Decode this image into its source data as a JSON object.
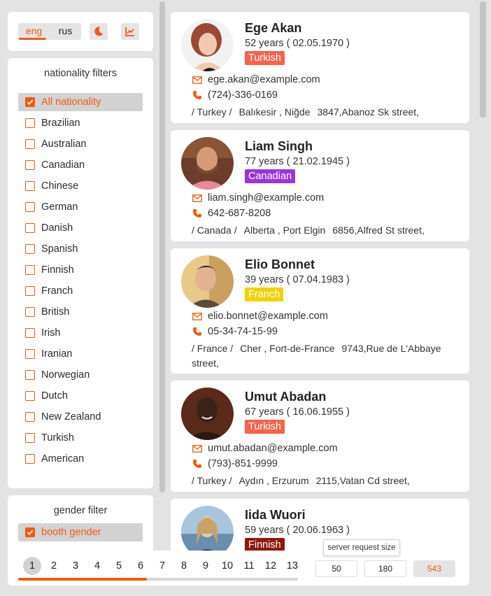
{
  "colors": {
    "accent": "#f05a14",
    "turkish": "#f4634a",
    "canadian": "#9a35d8",
    "franch": "#f4d000",
    "finnish": "#8b1a0e"
  },
  "language": {
    "eng": "eng",
    "rus": "rus",
    "selected": "eng"
  },
  "toolbar": {
    "theme_icon": "moon-icon",
    "chart_icon": "chart-icon"
  },
  "nationality_filters": {
    "title": "nationality filters",
    "items": [
      {
        "label": "All nationality",
        "checked": true
      },
      {
        "label": "Brazilian",
        "checked": false
      },
      {
        "label": "Australian",
        "checked": false
      },
      {
        "label": "Canadian",
        "checked": false
      },
      {
        "label": "Chinese",
        "checked": false
      },
      {
        "label": "German",
        "checked": false
      },
      {
        "label": "Danish",
        "checked": false
      },
      {
        "label": "Spanish",
        "checked": false
      },
      {
        "label": "Finnish",
        "checked": false
      },
      {
        "label": "Franch",
        "checked": false
      },
      {
        "label": "British",
        "checked": false
      },
      {
        "label": "Irish",
        "checked": false
      },
      {
        "label": "Iranian",
        "checked": false
      },
      {
        "label": "Norwegian",
        "checked": false
      },
      {
        "label": "Dutch",
        "checked": false
      },
      {
        "label": "New Zealand",
        "checked": false
      },
      {
        "label": "Turkish",
        "checked": false
      },
      {
        "label": "American",
        "checked": false
      }
    ]
  },
  "gender_filter": {
    "title": "gender filter",
    "items": [
      {
        "label": "booth gender",
        "checked": true
      }
    ]
  },
  "people": [
    {
      "name": "Ege Akan",
      "age": "52 years ( 02.05.1970 )",
      "nationality": "Turkish",
      "badge_color": "#f4634a",
      "email": "ege.akan@example.com",
      "phone": "(724)-336-0169",
      "address": [
        "/ Turkey /",
        "Balıkesir , Niğde",
        "3847,Abanoz Sk street,"
      ]
    },
    {
      "name": "Liam Singh",
      "age": "77 years ( 21.02.1945 )",
      "nationality": "Canadian",
      "badge_color": "#9a35d8",
      "email": "liam.singh@example.com",
      "phone": "642-687-8208",
      "address": [
        "/ Canada /",
        "Alberta , Port Elgin",
        "6856,Alfred St street,"
      ]
    },
    {
      "name": "Elio Bonnet",
      "age": "39 years ( 07.04.1983 )",
      "nationality": "Franch",
      "badge_color": "#f4d000",
      "email": "elio.bonnet@example.com",
      "phone": "05-34-74-15-99",
      "address": [
        "/ France /",
        "Cher , Fort-de-France",
        "9743,Rue de L'Abbaye street,"
      ]
    },
    {
      "name": "Umut Abadan",
      "age": "67 years ( 16.06.1955 )",
      "nationality": "Turkish",
      "badge_color": "#f4634a",
      "email": "umut.abadan@example.com",
      "phone": "(793)-851-9999",
      "address": [
        "/ Turkey /",
        "Aydın , Erzurum",
        "2115,Vatan Cd street,"
      ]
    },
    {
      "name": "Iida Wuori",
      "age": "59 years ( 20.06.1963 )",
      "nationality": "Finnish",
      "badge_color": "#8b1a0e"
    }
  ],
  "pagination": {
    "pages": [
      "1",
      "2",
      "3",
      "4",
      "5",
      "6",
      "7",
      "8",
      "9",
      "10",
      "11",
      "12",
      "13"
    ],
    "current": "1",
    "progress": 0.46
  },
  "request_size": {
    "tooltip": "server request size",
    "options": [
      "50",
      "180",
      "543"
    ],
    "selected": "543"
  }
}
